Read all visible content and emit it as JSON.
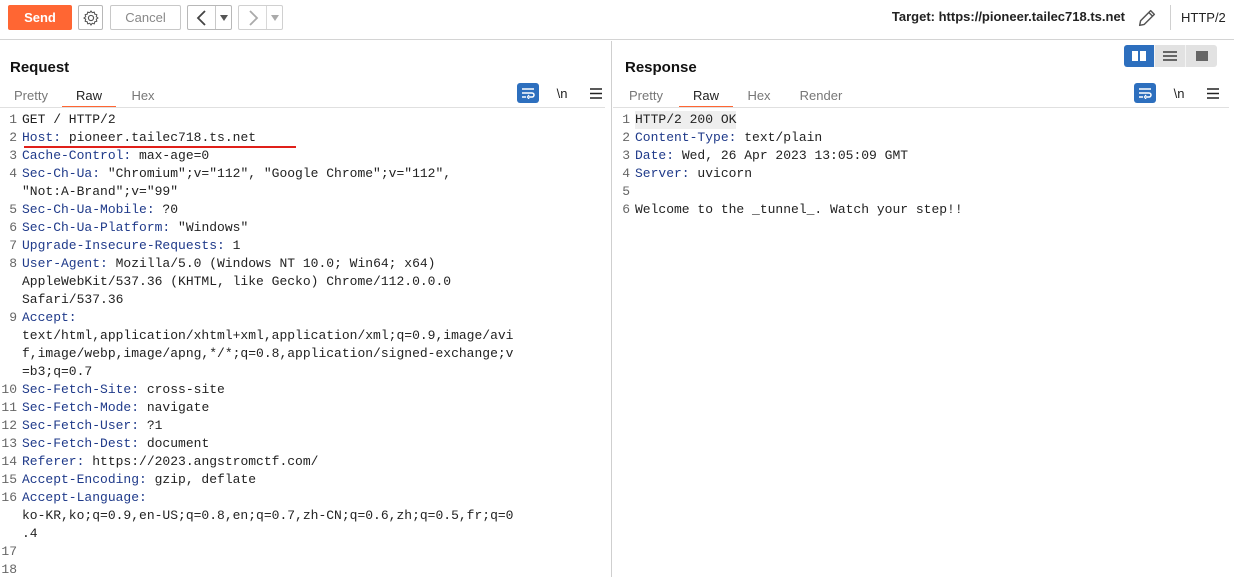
{
  "toolbar": {
    "send_label": "Send",
    "cancel_label": "Cancel",
    "target_text": "Target: https://pioneer.tailec718.ts.net",
    "http_version": "HTTP/2",
    "prev_icon": "chevron-left-icon",
    "next_icon": "chevron-right-icon",
    "accent": "#ff6633"
  },
  "request": {
    "title": "Request",
    "tabs": [
      "Pretty",
      "Raw",
      "Hex"
    ],
    "active_tab": "Raw",
    "newline_toggle": "\\n",
    "lines": [
      {
        "num": "1",
        "key": "",
        "value": "GET / HTTP/2"
      },
      {
        "num": "2",
        "key": "Host:",
        "value": " pioneer.tailec718.ts.net"
      },
      {
        "num": "3",
        "key": "Cache-Control:",
        "value": " max-age=0"
      },
      {
        "num": "4",
        "key": "Sec-Ch-Ua:",
        "value": " \"Chromium\";v=\"112\", \"Google Chrome\";v=\"112\","
      },
      {
        "num": "",
        "key": "",
        "value": "\"Not:A-Brand\";v=\"99\""
      },
      {
        "num": "5",
        "key": "Sec-Ch-Ua-Mobile:",
        "value": " ?0"
      },
      {
        "num": "6",
        "key": "Sec-Ch-Ua-Platform:",
        "value": " \"Windows\""
      },
      {
        "num": "7",
        "key": "Upgrade-Insecure-Requests:",
        "value": " 1"
      },
      {
        "num": "8",
        "key": "User-Agent:",
        "value": " Mozilla/5.0 (Windows NT 10.0; Win64; x64)"
      },
      {
        "num": "",
        "key": "",
        "value": "AppleWebKit/537.36 (KHTML, like Gecko) Chrome/112.0.0.0"
      },
      {
        "num": "",
        "key": "",
        "value": "Safari/537.36"
      },
      {
        "num": "9",
        "key": "Accept:",
        "value": ""
      },
      {
        "num": "",
        "key": "",
        "value": "text/html,application/xhtml+xml,application/xml;q=0.9,image/avi"
      },
      {
        "num": "",
        "key": "",
        "value": "f,image/webp,image/apng,*/*;q=0.8,application/signed-exchange;v"
      },
      {
        "num": "",
        "key": "",
        "value": "=b3;q=0.7"
      },
      {
        "num": "10",
        "key": "Sec-Fetch-Site:",
        "value": " cross-site"
      },
      {
        "num": "11",
        "key": "Sec-Fetch-Mode:",
        "value": " navigate"
      },
      {
        "num": "12",
        "key": "Sec-Fetch-User:",
        "value": " ?1"
      },
      {
        "num": "13",
        "key": "Sec-Fetch-Dest:",
        "value": " document"
      },
      {
        "num": "14",
        "key": "Referer:",
        "value": " https://2023.angstromctf.com/"
      },
      {
        "num": "15",
        "key": "Accept-Encoding:",
        "value": " gzip, deflate"
      },
      {
        "num": "16",
        "key": "Accept-Language:",
        "value": ""
      },
      {
        "num": "",
        "key": "",
        "value": "ko-KR,ko;q=0.9,en-US;q=0.8,en;q=0.7,zh-CN;q=0.6,zh;q=0.5,fr;q=0"
      },
      {
        "num": "",
        "key": "",
        "value": ".4"
      },
      {
        "num": "17",
        "key": "",
        "value": ""
      },
      {
        "num": "18",
        "key": "",
        "value": ""
      }
    ]
  },
  "response": {
    "title": "Response",
    "tabs": [
      "Pretty",
      "Raw",
      "Hex",
      "Render"
    ],
    "active_tab": "Raw",
    "newline_toggle": "\\n",
    "lines": [
      {
        "num": "1",
        "key": "",
        "value": "HTTP/2 200 OK"
      },
      {
        "num": "2",
        "key": "Content-Type:",
        "value": " text/plain"
      },
      {
        "num": "3",
        "key": "Date:",
        "value": " Wed, 26 Apr 2023 13:05:09 GMT"
      },
      {
        "num": "4",
        "key": "Server:",
        "value": " uvicorn"
      },
      {
        "num": "5",
        "key": "",
        "value": ""
      },
      {
        "num": "6",
        "key": "",
        "value": "Welcome to the _tunnel_. Watch your step!!"
      }
    ]
  }
}
